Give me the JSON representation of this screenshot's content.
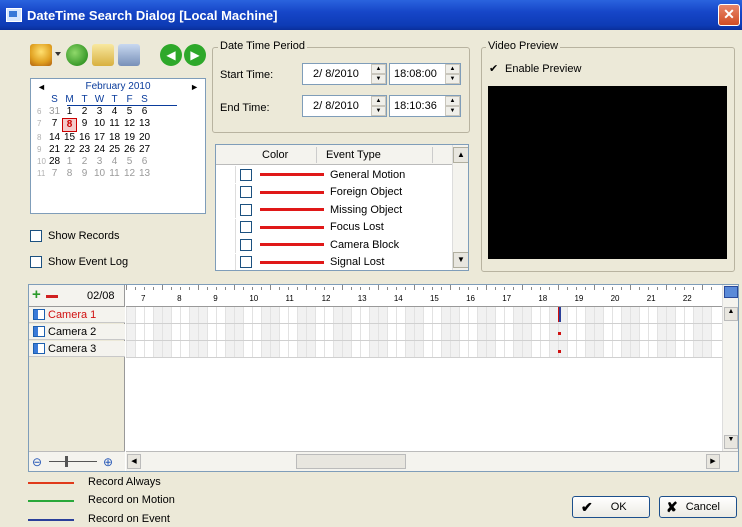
{
  "window": {
    "title": "DateTime Search Dialog  [Local Machine]",
    "close": "✕"
  },
  "calendar": {
    "month": "February 2010",
    "prev": "◄",
    "next": "►",
    "weekdays": [
      "S",
      "M",
      "T",
      "W",
      "T",
      "F",
      "S"
    ],
    "weeks": [
      {
        "num": "6",
        "days": [
          {
            "t": "31",
            "g": true
          },
          {
            "t": "1"
          },
          {
            "t": "2"
          },
          {
            "t": "3"
          },
          {
            "t": "4"
          },
          {
            "t": "5"
          },
          {
            "t": "6"
          }
        ]
      },
      {
        "num": "7",
        "days": [
          {
            "t": "7"
          },
          {
            "t": "8",
            "sel": true
          },
          {
            "t": "9"
          },
          {
            "t": "10"
          },
          {
            "t": "11"
          },
          {
            "t": "12"
          },
          {
            "t": "13"
          }
        ]
      },
      {
        "num": "8",
        "days": [
          {
            "t": "14"
          },
          {
            "t": "15"
          },
          {
            "t": "16"
          },
          {
            "t": "17"
          },
          {
            "t": "18"
          },
          {
            "t": "19"
          },
          {
            "t": "20"
          }
        ]
      },
      {
        "num": "9",
        "days": [
          {
            "t": "21"
          },
          {
            "t": "22"
          },
          {
            "t": "23"
          },
          {
            "t": "24"
          },
          {
            "t": "25"
          },
          {
            "t": "26"
          },
          {
            "t": "27"
          }
        ]
      },
      {
        "num": "10",
        "days": [
          {
            "t": "28"
          },
          {
            "t": "1",
            "g": true
          },
          {
            "t": "2",
            "g": true
          },
          {
            "t": "3",
            "g": true
          },
          {
            "t": "4",
            "g": true
          },
          {
            "t": "5",
            "g": true
          },
          {
            "t": "6",
            "g": true
          }
        ]
      },
      {
        "num": "11",
        "days": [
          {
            "t": "7",
            "g": true
          },
          {
            "t": "8",
            "g": true
          },
          {
            "t": "9",
            "g": true
          },
          {
            "t": "10",
            "g": true
          },
          {
            "t": "11",
            "g": true
          },
          {
            "t": "12",
            "g": true
          },
          {
            "t": "13",
            "g": true
          }
        ]
      }
    ]
  },
  "options": {
    "show_records": "Show Records",
    "show_event_log": "Show Event Log"
  },
  "datetime": {
    "group_label": "Date Time Period",
    "start_label": "Start Time:",
    "start_date": "2/  8/2010",
    "start_time": "18:08:00",
    "end_label": "End Time:",
    "end_date": "2/  8/2010",
    "end_time": "18:10:36"
  },
  "events": {
    "col_color": "Color",
    "col_type": "Event Type",
    "rows": [
      "General Motion",
      "Foreign Object",
      "Missing Object",
      "Focus Lost",
      "Camera Block",
      "Signal Lost"
    ],
    "line_color": "#e01818"
  },
  "preview": {
    "group_label": "Video Preview",
    "enable_label": "Enable Preview",
    "enabled": true
  },
  "timeline": {
    "date": "02/08",
    "hours": [
      "7",
      "8",
      "9",
      "10",
      "11",
      "12",
      "13",
      "14",
      "15",
      "16",
      "17",
      "18",
      "19",
      "20",
      "21",
      "22"
    ],
    "cameras": [
      "Camera 1",
      "Camera 2",
      "Camera 3"
    ]
  },
  "legend": [
    {
      "label": "Record Always",
      "color": "#e03a1a"
    },
    {
      "label": "Record on Motion",
      "color": "#2aa83a"
    },
    {
      "label": "Record on Event",
      "color": "#2a3f9a"
    }
  ],
  "buttons": {
    "ok": "OK",
    "cancel": "Cancel"
  },
  "icons": [
    "home-icon",
    "dropdown-arrow-icon",
    "link-icon",
    "search-folder-icon",
    "settings-icon",
    "back-icon",
    "forward-icon"
  ]
}
